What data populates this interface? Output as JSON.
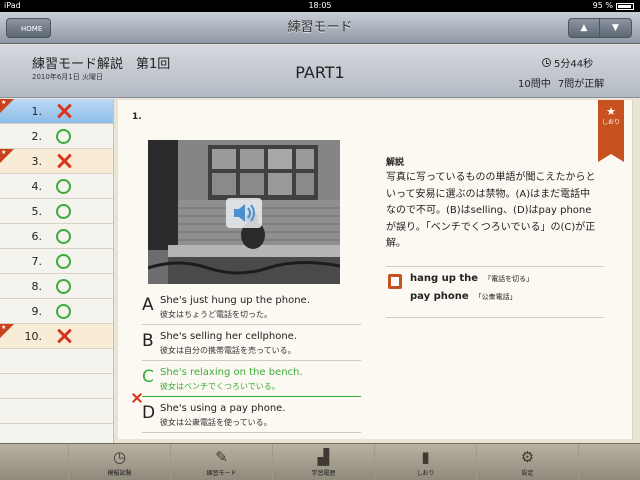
{
  "status_bar": {
    "device": "iPad",
    "time": "18:05",
    "battery": "95 %"
  },
  "nav": {
    "home_label": "HOME",
    "title": "練習モード",
    "prev_arrow": "▲",
    "next_arrow": "▼"
  },
  "header": {
    "title": "練習モード解説　第1回",
    "date": "2010年6月1日 火曜日",
    "part": "PART1",
    "elapsed": "5分44秒",
    "score": "10問中 7問が正解"
  },
  "question_list": [
    {
      "num": "1.",
      "result": "cross",
      "result_icon": "cross-icon",
      "bookmarked": true,
      "selected": true
    },
    {
      "num": "2.",
      "result": "circle",
      "result_icon": "circle-icon",
      "bookmarked": false,
      "selected": false
    },
    {
      "num": "3.",
      "result": "cross",
      "result_icon": "cross-icon",
      "bookmarked": true,
      "selected": false
    },
    {
      "num": "4.",
      "result": "circle",
      "result_icon": "circle-icon",
      "bookmarked": false,
      "selected": false
    },
    {
      "num": "5.",
      "result": "circle",
      "result_icon": "circle-icon",
      "bookmarked": false,
      "selected": false
    },
    {
      "num": "6.",
      "result": "circle",
      "result_icon": "circle-icon",
      "bookmarked": false,
      "selected": false
    },
    {
      "num": "7.",
      "result": "circle",
      "result_icon": "circle-icon",
      "bookmarked": false,
      "selected": false
    },
    {
      "num": "8.",
      "result": "circle",
      "result_icon": "circle-icon",
      "bookmarked": false,
      "selected": false
    },
    {
      "num": "9.",
      "result": "circle",
      "result_icon": "circle-icon",
      "bookmarked": false,
      "selected": false
    },
    {
      "num": "10.",
      "result": "cross",
      "result_icon": "cross-icon",
      "bookmarked": true,
      "selected": false
    }
  ],
  "question": {
    "number": "1.",
    "bookmark_label": "しおり",
    "choices": [
      {
        "letter": "A",
        "en": "She's just hung up the phone.",
        "jp": "彼女はちょうど電話を切った。",
        "status": "wrong"
      },
      {
        "letter": "B",
        "en": "She's selling her cellphone.",
        "jp": "彼女は自分の携帯電話を売っている。",
        "status": "normal"
      },
      {
        "letter": "C",
        "en": "She's relaxing on the bench.",
        "jp": "彼女はベンチでくつろいでいる。",
        "status": "correct"
      },
      {
        "letter": "D",
        "en": "She's using a pay phone.",
        "jp": "彼女は公衆電話を使っている。",
        "status": "normal"
      }
    ]
  },
  "explanation": {
    "title": "解説",
    "body": "写真に写っているものの単語が聞こえたからといって安易に選ぶのは禁物。(A)はまだ電話中なので不可。(B)はselling、(D)はpay phoneが誤り。「ベンチでくつろいでいる」の(C)が正解。"
  },
  "vocabulary": [
    {
      "term": "hang up the",
      "meaning": "「電話を切る」"
    },
    {
      "term": "pay phone",
      "meaning": "「公衆電話」"
    }
  ],
  "tabbar": [
    {
      "label": "模擬試験",
      "icon": "clock-book-icon"
    },
    {
      "label": "練習モード",
      "icon": "pencil-note-icon"
    },
    {
      "label": "学習履歴",
      "icon": "chart-icon"
    },
    {
      "label": "しおり",
      "icon": "bookmark-icon"
    },
    {
      "label": "設定",
      "icon": "gear-icon"
    }
  ],
  "colors": {
    "accent": "#c8521f",
    "correct": "#3caa3a",
    "wrong": "#d9361f",
    "selected_row": "#8dbde8"
  }
}
